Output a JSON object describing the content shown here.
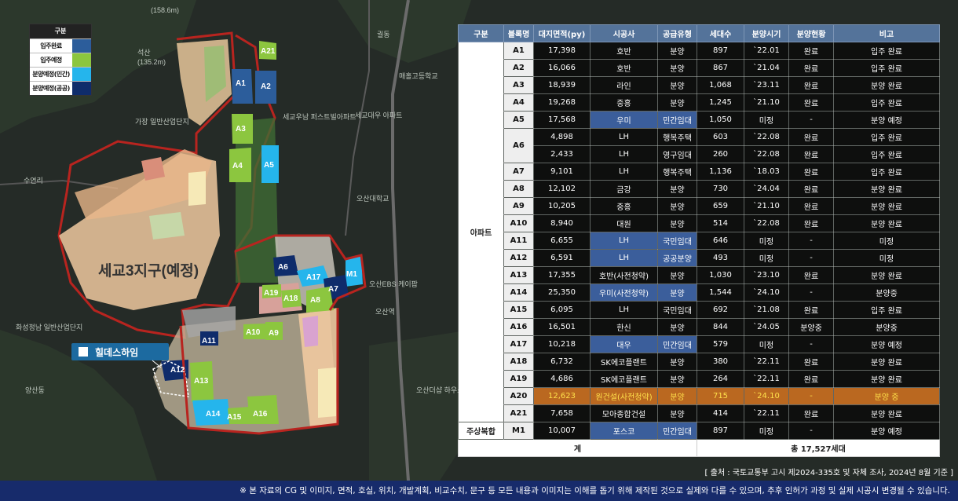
{
  "legend": {
    "title": "구분",
    "items": [
      {
        "label": "입주완료",
        "color": "#2c5d9b"
      },
      {
        "label": "입주예정",
        "color": "#8cc63f"
      },
      {
        "label": "분양예정(민간)",
        "color": "#25b5ec"
      },
      {
        "label": "분양예정(공공)",
        "color": "#0f2c6b"
      }
    ]
  },
  "map": {
    "district_label": "세교3지구(예정)",
    "marker_label": "힐데스하임",
    "blocks": [
      "A21",
      "A1",
      "A2",
      "A3",
      "A4",
      "A5",
      "A6",
      "A7",
      "A8",
      "A9",
      "A10",
      "A11",
      "A12",
      "A13",
      "A14",
      "A15",
      "A16",
      "A17",
      "A18",
      "A19",
      "M1"
    ],
    "place_labels": [
      "(158.6m)",
      "석산",
      "(135.2m)",
      "가장 일반산업단지",
      "세교우남 퍼스트빌아파트",
      "세교대우 아파트",
      "오산대학교",
      "매홀고등학교",
      "수연리",
      "화성정남 일반산업단지",
      "오산EBS 케이팝",
      "오산역",
      "궐동",
      "양산동",
      "오산더샵 하우스디"
    ]
  },
  "table": {
    "headers": [
      "구분",
      "블록명",
      "대지면적(py)",
      "시공사",
      "공급유형",
      "세대수",
      "분양시기",
      "분양현황",
      "비고"
    ],
    "groups": [
      {
        "category": "아파트",
        "rows": [
          {
            "block": "A1",
            "area": "17,398",
            "builder": "호반",
            "type": "분양",
            "units": "897",
            "date": "`22.01",
            "status": "완료",
            "note": "입주 완료"
          },
          {
            "block": "A2",
            "area": "16,066",
            "builder": "호반",
            "type": "분양",
            "units": "867",
            "date": "`21.04",
            "status": "완료",
            "note": "입주 완료"
          },
          {
            "block": "A3",
            "area": "18,939",
            "builder": "라인",
            "type": "분양",
            "units": "1,068",
            "date": "`23.11",
            "status": "완료",
            "note": "분양 완료"
          },
          {
            "block": "A4",
            "area": "19,268",
            "builder": "중흥",
            "type": "분양",
            "units": "1,245",
            "date": "`21.10",
            "status": "완료",
            "note": "입주 완료"
          },
          {
            "block": "A5",
            "area": "17,568",
            "builder": "우미",
            "type": "민간임대",
            "units": "1,050",
            "date": "미정",
            "status": "-",
            "note": "분양 예정",
            "hl": true
          },
          {
            "block": "A6",
            "area": "4,898",
            "builder": "LH",
            "type": "행복주택",
            "units": "603",
            "date": "`22.08",
            "status": "완료",
            "note": "입주 완료",
            "span": 2
          },
          {
            "block": "",
            "area": "2,433",
            "builder": "LH",
            "type": "영구임대",
            "units": "260",
            "date": "`22.08",
            "status": "완료",
            "note": "입주 완료",
            "cont": true
          },
          {
            "block": "A7",
            "area": "9,101",
            "builder": "LH",
            "type": "행복주택",
            "units": "1,136",
            "date": "`18.03",
            "status": "완료",
            "note": "입주 완료"
          },
          {
            "block": "A8",
            "area": "12,102",
            "builder": "금강",
            "type": "분양",
            "units": "730",
            "date": "`24.04",
            "status": "완료",
            "note": "분양 완료"
          },
          {
            "block": "A9",
            "area": "10,205",
            "builder": "중흥",
            "type": "분양",
            "units": "659",
            "date": "`21.10",
            "status": "완료",
            "note": "분양 완료"
          },
          {
            "block": "A10",
            "area": "8,940",
            "builder": "대원",
            "type": "분양",
            "units": "514",
            "date": "`22.08",
            "status": "완료",
            "note": "분양 완료"
          },
          {
            "block": "A11",
            "area": "6,655",
            "builder": "LH",
            "type": "국민임대",
            "units": "646",
            "date": "미정",
            "status": "-",
            "note": "미정",
            "hl": true
          },
          {
            "block": "A12",
            "area": "6,591",
            "builder": "LH",
            "type": "공공분양",
            "units": "493",
            "date": "미정",
            "status": "-",
            "note": "미정",
            "hl": true
          },
          {
            "block": "A13",
            "area": "17,355",
            "builder": "호반(사전청약)",
            "type": "분양",
            "units": "1,030",
            "date": "`23.10",
            "status": "완료",
            "note": "분양 완료"
          },
          {
            "block": "A14",
            "area": "25,350",
            "builder": "우미(사전청약)",
            "type": "분양",
            "units": "1,544",
            "date": "`24.10",
            "status": "-",
            "note": "분양중",
            "hl": true
          },
          {
            "block": "A15",
            "area": "6,095",
            "builder": "LH",
            "type": "국민임대",
            "units": "692",
            "date": "`21.08",
            "status": "완료",
            "note": "입주 완료"
          },
          {
            "block": "A16",
            "area": "16,501",
            "builder": "한신",
            "type": "분양",
            "units": "844",
            "date": "`24.05",
            "status": "분양중",
            "note": "분양중"
          },
          {
            "block": "A17",
            "area": "10,218",
            "builder": "대우",
            "type": "민간임대",
            "units": "579",
            "date": "미정",
            "status": "-",
            "note": "분양 예정",
            "hl": true
          },
          {
            "block": "A18",
            "area": "6,732",
            "builder": "SK에코플랜트",
            "type": "분양",
            "units": "380",
            "date": "`22.11",
            "status": "완료",
            "note": "분양 완료"
          },
          {
            "block": "A19",
            "area": "4,686",
            "builder": "SK에코플랜트",
            "type": "분양",
            "units": "264",
            "date": "`22.11",
            "status": "완료",
            "note": "분양 완료"
          },
          {
            "block": "A20",
            "area": "12,623",
            "builder": "원건설(사전청약)",
            "type": "분양",
            "units": "715",
            "date": "`24.10",
            "status": "-",
            "note": "분양 중",
            "highlight_row": true
          },
          {
            "block": "A21",
            "area": "7,658",
            "builder": "모아종합건설",
            "type": "분양",
            "units": "414",
            "date": "`22.11",
            "status": "완료",
            "note": "분양 완료"
          }
        ]
      },
      {
        "category": "주상복합",
        "rows": [
          {
            "block": "M1",
            "area": "10,007",
            "builder": "포스코",
            "type": "민간임대",
            "units": "897",
            "date": "미정",
            "status": "-",
            "note": "분양 예정",
            "hl": true
          }
        ]
      }
    ],
    "total_label": "계",
    "total_value": "총 17,527세대",
    "highlight_color": "#ba6820",
    "header_color": "#54739a"
  },
  "source": "[ 출처 : 국토교통부 고시 제2024-335호 및 자체 조사, 2024년 8월 기준 ]",
  "footer": "※ 본 자료의 CG 및 이미지, 면적, 호실, 위치, 개발계획, 비교수치, 문구 등 모든 내용과 이미지는 이해를 돕기 위해 제작된 것으로 실제와 다를 수 있으며, 추후 인허가 과정 및 실제 시공시 변경될 수 있습니다."
}
